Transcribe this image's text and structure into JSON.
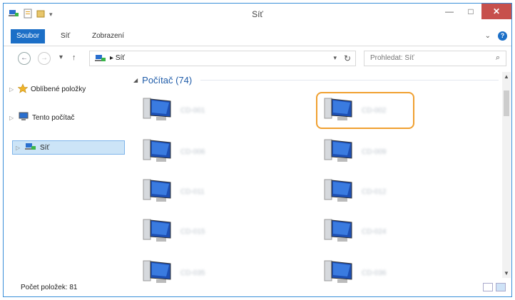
{
  "window": {
    "title": "Síť"
  },
  "ribbon": {
    "tabs": [
      "Soubor",
      "Síť",
      "Zobrazení"
    ]
  },
  "address": {
    "path": "Síť",
    "separator": "▸"
  },
  "search": {
    "placeholder": "Prohledat: Síť"
  },
  "nav": {
    "items": [
      "Oblíbené položky",
      "Tento počítač",
      "Síť"
    ],
    "selected": "Síť"
  },
  "content": {
    "group_title": "Počítač (74)",
    "items": [
      {
        "name": "CD-001"
      },
      {
        "name": "CD-002",
        "highlighted": true
      },
      {
        "name": "CD-006"
      },
      {
        "name": "CD-009"
      },
      {
        "name": "CD-011"
      },
      {
        "name": "CD-012"
      },
      {
        "name": "CD-015"
      },
      {
        "name": "CD-024"
      },
      {
        "name": "CD-035"
      },
      {
        "name": "CD-036"
      }
    ]
  },
  "status": {
    "count_text": "Počet položek: 81"
  },
  "colors": {
    "accent": "#1c6fc7",
    "close": "#c7504c",
    "highlight_outline": "#f0a030",
    "group_title": "#1e5ba8"
  },
  "icons": [
    "network-icon",
    "document-icon",
    "folder-icon",
    "star-icon",
    "computer-icon",
    "search-icon",
    "refresh-icon",
    "help-icon"
  ]
}
